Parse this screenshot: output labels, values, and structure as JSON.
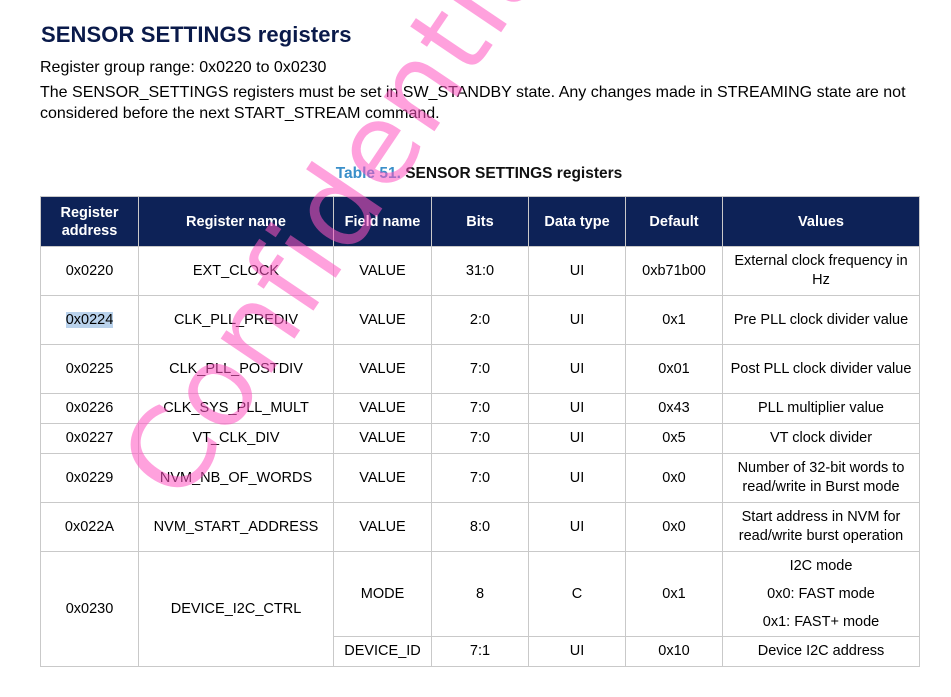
{
  "heading": "SENSOR SETTINGS registers",
  "group_range": "Register group range: 0x0220 to 0x0230",
  "description": "The SENSOR_SETTINGS registers must be set in SW_STANDBY state. Any changes made in STREAMING state are not considered before the next START_STREAM command.",
  "table_caption": {
    "number": "Table 51.",
    "title": "SENSOR SETTINGS registers"
  },
  "columns": [
    "Register address",
    "Register name",
    "Field name",
    "Bits",
    "Data type",
    "Default",
    "Values"
  ],
  "rows": [
    {
      "address": "0x0220",
      "name": "EXT_CLOCK",
      "field": "VALUE",
      "bits": "31:0",
      "type": "UI",
      "default": "0xb71b00",
      "values": "External clock frequency in Hz"
    },
    {
      "address": "0x0224",
      "name": "CLK_PLL_PREDIV",
      "field": "VALUE",
      "bits": "2:0",
      "type": "UI",
      "default": "0x1",
      "values": "Pre PLL clock divider value"
    },
    {
      "address": "0x0225",
      "name": "CLK_PLL_POSTDIV",
      "field": "VALUE",
      "bits": "7:0",
      "type": "UI",
      "default": "0x01",
      "values": "Post PLL clock divider value"
    },
    {
      "address": "0x0226",
      "name": "CLK_SYS_PLL_MULT",
      "field": "VALUE",
      "bits": "7:0",
      "type": "UI",
      "default": "0x43",
      "values": "PLL multiplier value"
    },
    {
      "address": "0x0227",
      "name": "VT_CLK_DIV",
      "field": "VALUE",
      "bits": "7:0",
      "type": "UI",
      "default": "0x5",
      "values": "VT clock divider"
    },
    {
      "address": "0x0229",
      "name": "NVM_NB_OF_WORDS",
      "field": "VALUE",
      "bits": "7:0",
      "type": "UI",
      "default": "0x0",
      "values": "Number of 32-bit words to read/write in Burst mode"
    },
    {
      "address": "0x022A",
      "name": "NVM_START_ADDRESS",
      "field": "VALUE",
      "bits": "8:0",
      "type": "UI",
      "default": "0x0",
      "values": "Start address in NVM for read/write burst operation"
    }
  ],
  "device_i2c": {
    "address": "0x0230",
    "name": "DEVICE_I2C_CTRL",
    "mode": {
      "field": "MODE",
      "bits": "8",
      "type": "C",
      "default": "0x1",
      "values": [
        "I2C mode",
        "0x0: FAST mode",
        "0x1: FAST+ mode"
      ]
    },
    "device_id": {
      "field": "DEVICE_ID",
      "bits": "7:1",
      "type": "UI",
      "default": "0x10",
      "values": "Device I2C address"
    }
  },
  "watermark": "Confidential"
}
